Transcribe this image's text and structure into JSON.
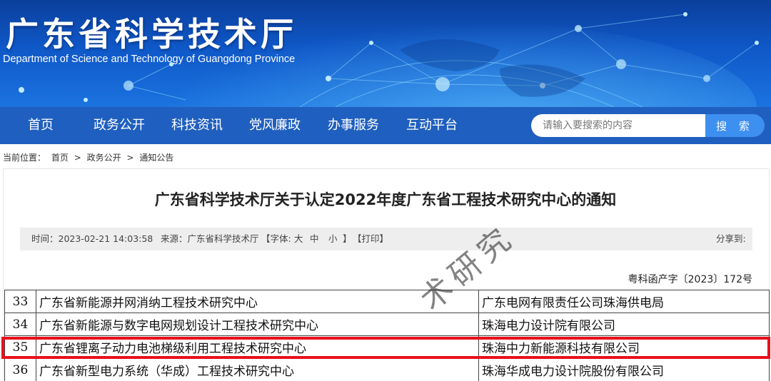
{
  "header": {
    "title": "广东省科学技术厅",
    "subtitle": "Department of Science and Technology of Guangdong Province"
  },
  "nav": {
    "items": [
      "首页",
      "政务公开",
      "科技资讯",
      "党风廉政",
      "办事服务",
      "互动平台"
    ],
    "search_placeholder": "请输入要搜索的内容",
    "search_button": "搜 索"
  },
  "breadcrumb": {
    "prefix": "当前位置：",
    "items": [
      "首页",
      "政务公开",
      "通知公告"
    ],
    "separator": ">"
  },
  "article": {
    "title": "广东省科学技术厅关于认定2022年度广东省工程技术研究中心的通知",
    "meta": {
      "time": "时间：2023-02-21 14:03:58",
      "source": "来源：广东省科学技术厅",
      "font_label": "【字体:",
      "font_large": "大",
      "font_medium": "中",
      "font_small": "小",
      "font_close": "】",
      "print": "【打印】",
      "share": "分享到:"
    },
    "doc_number": "粤科函产字〔2023〕172号",
    "watermark": "术研究"
  },
  "table": {
    "rows": [
      {
        "num": "33",
        "name": "广东省新能源并网消纳工程技术研究中心",
        "org": "广东电网有限责任公司珠海供电局"
      },
      {
        "num": "34",
        "name": "广东省新能源与数字电网规划设计工程技术研究中心",
        "org": "珠海电力设计院有限公司"
      },
      {
        "num": "35",
        "name": "广东省锂离子动力电池梯级利用工程技术研究中心",
        "org": "珠海中力新能源科技有限公司"
      },
      {
        "num": "36",
        "name": "广东省新型电力系统（华成）工程技术研究中心",
        "org": "珠海华成电力设计院股份有限公司"
      }
    ],
    "highlight_color": "#e8101c"
  },
  "colors": {
    "banner": "#0f58c8",
    "nav": "#1f5fbf",
    "search_button": "#3d8ff0"
  }
}
